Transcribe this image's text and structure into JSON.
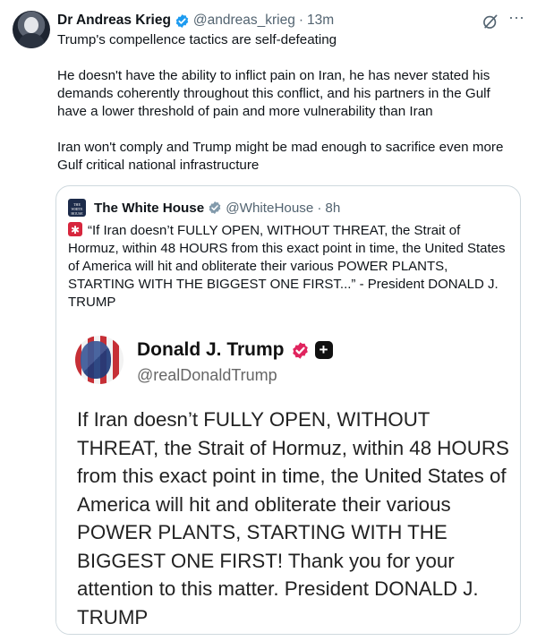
{
  "author": {
    "name": "Dr Andreas Krieg",
    "handle": "@andreas_krieg",
    "separator": "·",
    "time": "13m"
  },
  "tweet": {
    "text": "Trump's compellence tactics are self-defeating\n\nHe doesn't have the ability to inflict pain on Iran, he has never stated his demands coherently throughout this conflict, and his partners in the Gulf have a lower threshold of pain and more vulnerability than Iran\n\nIran won't comply and Trump might be mad enough to sacrifice even more Gulf critical national infrastructure"
  },
  "quoted": {
    "avatar_text": "THE WHITE HOUSE",
    "name": "The White House",
    "handle": "@WhiteHouse",
    "separator": "·",
    "time": "8h",
    "text": "“If Iran doesn’t FULLY OPEN, WITHOUT THREAT, the Strait of Hormuz, within 48 HOURS from this exact point in time, the United States of America will hit and obliterate their various POWER PLANTS, STARTING WITH THE BIGGEST ONE FIRST...” - President DONALD J. TRUMP",
    "image": {
      "name": "Donald J. Trump",
      "handle": "@realDonaldTrump",
      "plus": "+",
      "text": "If Iran doesn’t FULLY OPEN, WITHOUT THREAT, the Strait of Hormuz, within 48 HOURS from this exact point in time, the United States of America will hit and obliterate their various POWER PLANTS, STARTING WITH THE BIGGEST ONE FIRST! Thank you for your attention to this matter. President DONALD J. TRUMP"
    }
  },
  "icons": {
    "verified": "verified-badge-icon",
    "grok": "grok-icon",
    "more": "more-icon",
    "siren": "siren-icon"
  },
  "colors": {
    "verified_blue": "#1d9bf0",
    "truth_badge_red": "#e0245e",
    "secondary_text": "#536471",
    "border": "#cfd9de"
  }
}
